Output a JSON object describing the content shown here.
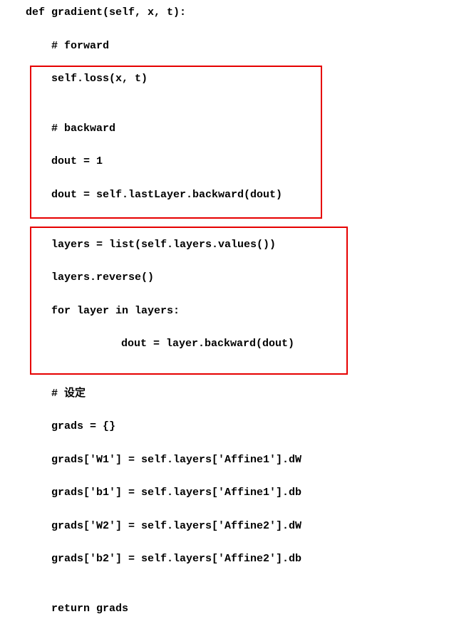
{
  "code": {
    "l1": "def gradient(self, x, t):",
    "l2": "# forward",
    "l3": "self.loss(x, t)",
    "l4": "",
    "l5": "# backward",
    "l6": "dout = 1",
    "l7": "dout = self.lastLayer.backward(dout)",
    "l8": "",
    "l9": "layers = list(self.layers.values())",
    "l10": "layers.reverse()",
    "l11": "for layer in layers:",
    "l12": "dout = layer.backward(dout)",
    "l13": "",
    "l14": "# 设定",
    "l15": "grads = {}",
    "l16": "grads['W1'] = self.layers['Affine1'].dW",
    "l17": "grads['b1'] = self.layers['Affine1'].db",
    "l18": "grads['W2'] = self.layers['Affine2'].dW",
    "l19": "grads['b2'] = self.layers['Affine2'].db",
    "l20": "",
    "l21": "return grads"
  }
}
